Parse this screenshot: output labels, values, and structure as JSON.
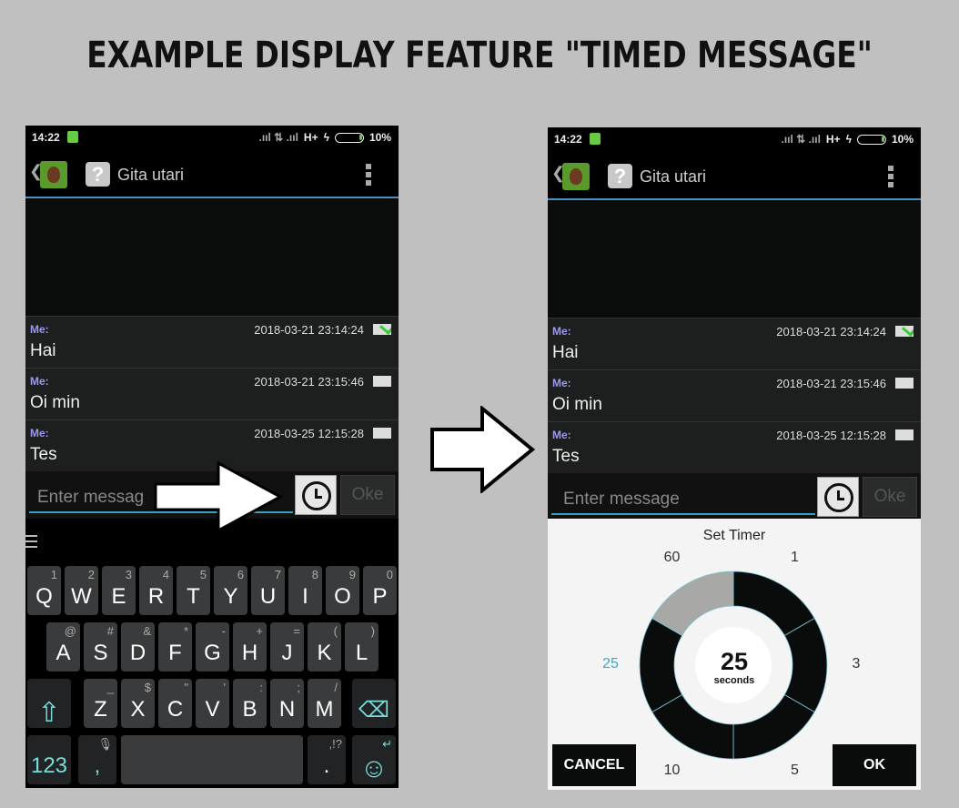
{
  "title": "EXAMPLE DISPLAY FEATURE \"TIMED MESSAGE\"",
  "status": {
    "time": "14:22",
    "network": "H+",
    "battery": "10%"
  },
  "contact": {
    "name": "Gita utari"
  },
  "messages": [
    {
      "sender": "Me:",
      "timestamp": "2018-03-21 23:14:24",
      "text": "Hai",
      "status": "delivered"
    },
    {
      "sender": "Me:",
      "timestamp": "2018-03-21 23:15:46",
      "text": "Oi min",
      "status": "sent"
    },
    {
      "sender": "Me:",
      "timestamp": "2018-03-25 12:15:28",
      "text": "Tes",
      "status": "sent"
    }
  ],
  "input": {
    "placeholder_left": "Enter messag",
    "placeholder": "Enter message",
    "send_label": "Oke"
  },
  "keyboard": {
    "row1": [
      [
        "Q",
        "1"
      ],
      [
        "W",
        "2"
      ],
      [
        "E",
        "3"
      ],
      [
        "R",
        "4"
      ],
      [
        "T",
        "5"
      ],
      [
        "Y",
        "6"
      ],
      [
        "U",
        "7"
      ],
      [
        "I",
        "8"
      ],
      [
        "O",
        "9"
      ],
      [
        "P",
        "0"
      ]
    ],
    "row2": [
      [
        "A",
        "@"
      ],
      [
        "S",
        "#"
      ],
      [
        "D",
        "&"
      ],
      [
        "F",
        "*"
      ],
      [
        "G",
        "-"
      ],
      [
        "H",
        "+"
      ],
      [
        "J",
        "="
      ],
      [
        "K",
        "("
      ],
      [
        "L",
        ")"
      ]
    ],
    "row3": [
      [
        "Z",
        "_"
      ],
      [
        "X",
        "$"
      ],
      [
        "C",
        "\""
      ],
      [
        "V",
        "'"
      ],
      [
        "B",
        ":"
      ],
      [
        "N",
        ";"
      ],
      [
        "M",
        "/"
      ]
    ],
    "numbers_label": "123",
    "comma": ",",
    "period": ".",
    "period_alt": ",!?"
  },
  "timer": {
    "title": "Set Timer",
    "options": [
      "1",
      "3",
      "5",
      "10",
      "25",
      "60"
    ],
    "selected": "25",
    "selected_value": "25",
    "unit": "seconds",
    "cancel_label": "CANCEL",
    "ok_label": "OK",
    "colors": {
      "segment": "#0a0c0c",
      "selected_segment_track": "#a8a8a6",
      "selected_label": "#3aa8c8"
    }
  }
}
